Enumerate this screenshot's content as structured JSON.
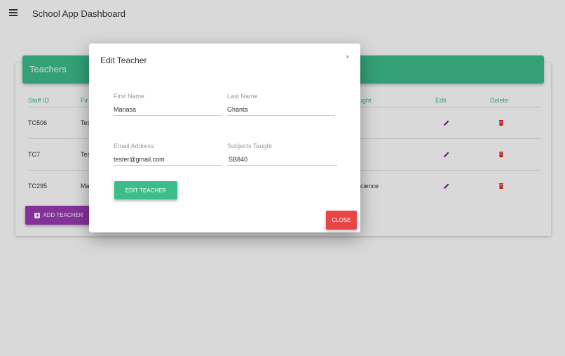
{
  "app": {
    "title": "School App Dashboard"
  },
  "card": {
    "title": "Teachers",
    "columns": [
      "Staff ID",
      "Fir",
      "ught",
      "Edit",
      "Delete"
    ],
    "rows": [
      {
        "staff_id": "TC506",
        "first": "Tes",
        "subject": ""
      },
      {
        "staff_id": "TC7",
        "first": "Tes",
        "subject": ""
      },
      {
        "staff_id": "TC295",
        "first": "Ma",
        "subject": "cience"
      }
    ],
    "add_label": "ADD TEACHER"
  },
  "modal": {
    "title": "Edit Teacher",
    "close_x": "×",
    "first_name": {
      "label": "First Name",
      "value": "Manasa"
    },
    "last_name": {
      "label": "Last Name",
      "value": "Ghanta"
    },
    "email": {
      "label": "Email Address",
      "value": "tester@gmail.com"
    },
    "subjects": {
      "label": "Subjects Taught",
      "value": "SB840"
    },
    "submit_label": "EDIT TEACHER",
    "close_label": "CLOSE"
  },
  "colors": {
    "primary": "#3dbd8c",
    "purple": "#9c3bb5",
    "danger": "#ea4545"
  }
}
